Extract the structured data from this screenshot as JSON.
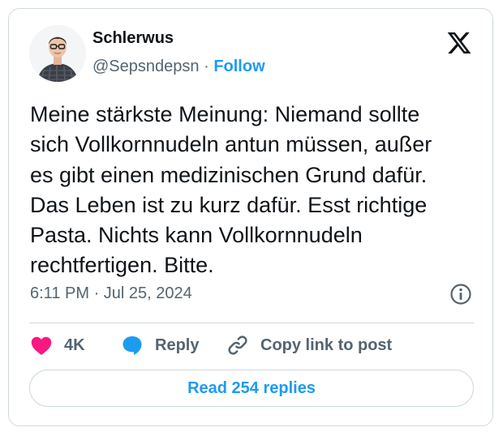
{
  "author": {
    "name": "Schlerwus",
    "handle": "@Sepsndepsn",
    "separator": "·",
    "follow_label": "Follow"
  },
  "tweet": {
    "lines": [
      "Meine stärkste Meinung: Niemand sollte",
      "sich Vollkornnudeln antun müssen, außer",
      "es gibt einen medizinischen Grund dafür.",
      "Das Leben ist zu kurz dafür. Esst richtige",
      "Pasta. Nichts kann Vollkornnudeln",
      "rechtfertigen. Bitte."
    ],
    "time": "6:11 PM",
    "separator": "·",
    "date": "Jul 25, 2024"
  },
  "actions": {
    "like_count": "4K",
    "reply_label": "Reply",
    "copy_label": "Copy link to post"
  },
  "read_replies_label": "Read 254 replies",
  "icons": {
    "brand": "x-logo-icon",
    "info": "info-icon",
    "like": "heart-icon",
    "reply": "speech-bubble-icon",
    "copy": "link-icon"
  },
  "colors": {
    "accent": "#1d9bf0",
    "heart": "#f91880",
    "text": "#0f1419",
    "muted": "#536471",
    "border": "#cfd9de"
  }
}
